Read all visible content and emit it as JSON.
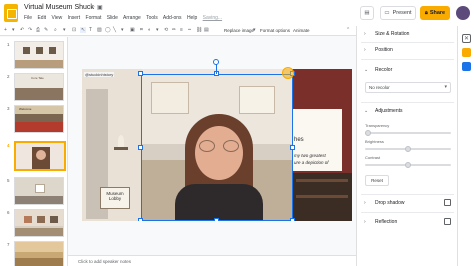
{
  "app": {
    "doc_title": "Virtual Museum Shuck",
    "menu": [
      "File",
      "Edit",
      "View",
      "Insert",
      "Format",
      "Slide",
      "Arrange",
      "Tools",
      "Add-ons",
      "Help"
    ],
    "save_status": "Saving...",
    "present_label": "Present",
    "share_label": "Share",
    "share_icon": "lock-icon"
  },
  "toolbar": {
    "replace_image": "Replace image",
    "format_options": "Format options",
    "animate": "Animate"
  },
  "filmstrip": {
    "slide_numbers": [
      "1",
      "2",
      "3",
      "4",
      "5",
      "6",
      "7"
    ],
    "thumbs": [
      {
        "caption": ""
      },
      {
        "caption": "Core Tale"
      },
      {
        "caption": "Welcome"
      },
      {
        "caption": ""
      },
      {
        "caption": ""
      },
      {
        "caption": ""
      },
      {
        "caption": ""
      }
    ]
  },
  "slide": {
    "handle_text": "@stuckinhistory",
    "sign_text": "Museum Lobby",
    "panel_title": "hes",
    "panel_lines": [
      "my two greatest",
      "ure a depiction of"
    ]
  },
  "panel": {
    "sections": {
      "size_rotation": "Size & Rotation",
      "position": "Position",
      "recolor": "Recolor",
      "recolor_value": "No recolor",
      "adjustments": "Adjustments",
      "transparency": "Transparency",
      "brightness": "Brightness",
      "contrast": "Contrast",
      "reset": "Reset",
      "drop_shadow": "Drop shadow",
      "reflection": "Reflection"
    },
    "sliders": {
      "transparency_level": 0.0,
      "brightness_level": 0.5,
      "contrast_level": 0.5
    }
  },
  "notes": {
    "placeholder": "Click to add speaker notes"
  },
  "colors": {
    "accent": "#f9ab00",
    "brand": "#f4b400",
    "selection": "#1a73e8"
  }
}
